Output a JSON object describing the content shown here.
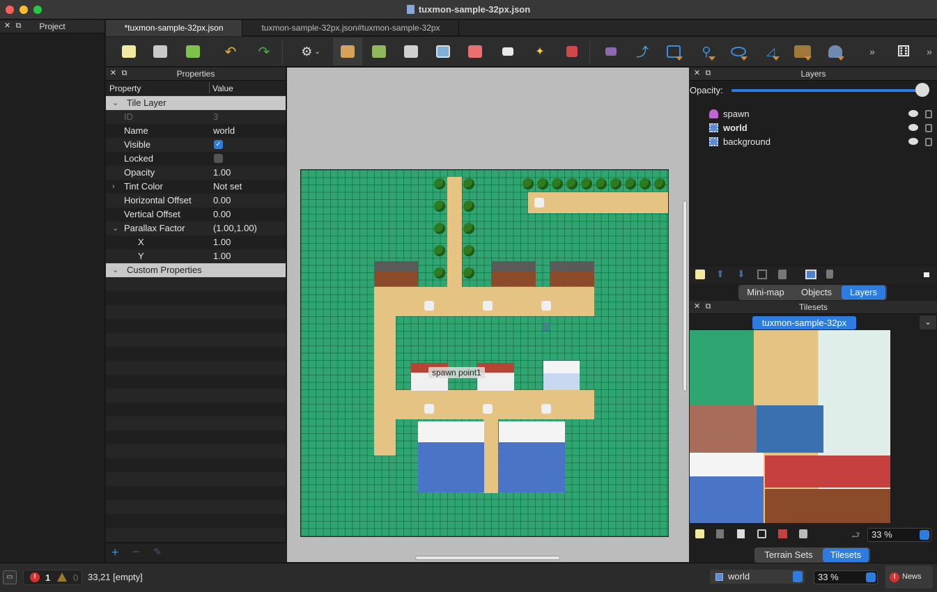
{
  "window": {
    "title": "tuxmon-sample-32px.json"
  },
  "project_panel": {
    "title": "Project"
  },
  "tabs": [
    {
      "label": "*tuxmon-sample-32px.json",
      "active": true
    },
    {
      "label": "tuxmon-sample-32px.json#tuxmon-sample-32px",
      "active": false
    }
  ],
  "properties": {
    "title": "Properties",
    "col_property": "Property",
    "col_value": "Value",
    "group_tile_layer": "Tile Layer",
    "rows": [
      {
        "name": "ID",
        "value": "3"
      },
      {
        "name": "Name",
        "value": "world"
      },
      {
        "name": "Visible",
        "value": ""
      },
      {
        "name": "Locked",
        "value": ""
      },
      {
        "name": "Opacity",
        "value": "1.00"
      },
      {
        "name": "Tint Color",
        "value": "Not set"
      },
      {
        "name": "Horizontal Offset",
        "value": "0.00"
      },
      {
        "name": "Vertical Offset",
        "value": "0.00"
      },
      {
        "name": "Parallax Factor",
        "value": "(1.00,1.00)"
      },
      {
        "name": "X",
        "value": "1.00"
      },
      {
        "name": "Y",
        "value": "1.00"
      }
    ],
    "group_custom": "Custom Properties",
    "visible_checked": true,
    "locked_checked": false
  },
  "map": {
    "object_label": "spawn point1"
  },
  "layers": {
    "title": "Layers",
    "opacity_label": "Opacity:",
    "opacity_value": 1.0,
    "items": [
      {
        "name": "spawn",
        "type": "object",
        "bold": false
      },
      {
        "name": "world",
        "type": "tile",
        "bold": true
      },
      {
        "name": "background",
        "type": "tile",
        "bold": false
      }
    ],
    "bottom_tabs": [
      "Mini-map",
      "Objects",
      "Layers"
    ],
    "active_bottom_tab": "Layers"
  },
  "tilesets": {
    "title": "Tilesets",
    "tab": "tuxmon-sample-32px",
    "zoom": "33 %",
    "bottom_tabs": [
      "Terrain Sets",
      "Tilesets"
    ],
    "active_bottom_tab": "Tilesets"
  },
  "status": {
    "errors": "1",
    "warnings": "0",
    "position": "33,21 [empty]",
    "layer_select": "world",
    "zoom": "33 %",
    "news": "News"
  },
  "colors": {
    "accent": "#2d7de0",
    "grass": "#2fa572",
    "path": "#e5c382",
    "error": "#d8302f"
  }
}
